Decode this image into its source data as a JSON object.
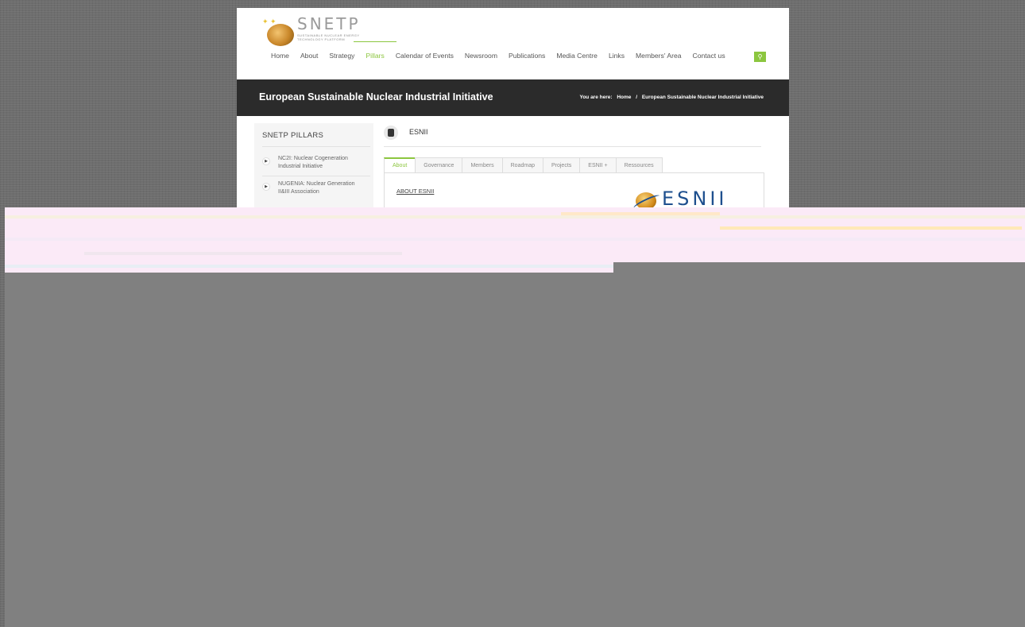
{
  "logo": {
    "name": "SNETP",
    "subtitle_line1": "Sustainable Nuclear Energy",
    "subtitle_line2": "Technology Platform"
  },
  "nav": {
    "items": [
      "Home",
      "About",
      "Strategy",
      "Pillars",
      "Calendar of Events",
      "Newsroom",
      "Publications",
      "Media Centre",
      "Links",
      "Members' Area",
      "Contact us"
    ],
    "active": "Pillars"
  },
  "search_icon": "search-icon",
  "banner": {
    "title": "European Sustainable Nuclear Industrial Initiative",
    "breadcrumb_prefix": "You are here:",
    "breadcrumb_home": "Home",
    "breadcrumb_sep": "/",
    "breadcrumb_current": "European Sustainable Nuclear Industrial Initiative"
  },
  "sidebar": {
    "title": "SNETP PILLARS",
    "items": [
      {
        "line1": "NC2I: Nuclear Cogeneration",
        "line2": "Industrial Initiative"
      },
      {
        "line1": "NUGENIA: Nuclear Generation",
        "line2": "II&III Association"
      }
    ]
  },
  "content": {
    "title": "ESNII",
    "tabs": [
      "About",
      "Governance",
      "Members",
      "Roadmap",
      "Projects",
      "ESNII +",
      "Ressources"
    ],
    "active_tab": "About",
    "about_label": "ABOUT ESNII",
    "logo_text": "ESNII"
  },
  "colors": {
    "accent": "#8cc63f",
    "band": "#2b2b2b",
    "esnii_blue": "#1e4f8e"
  }
}
